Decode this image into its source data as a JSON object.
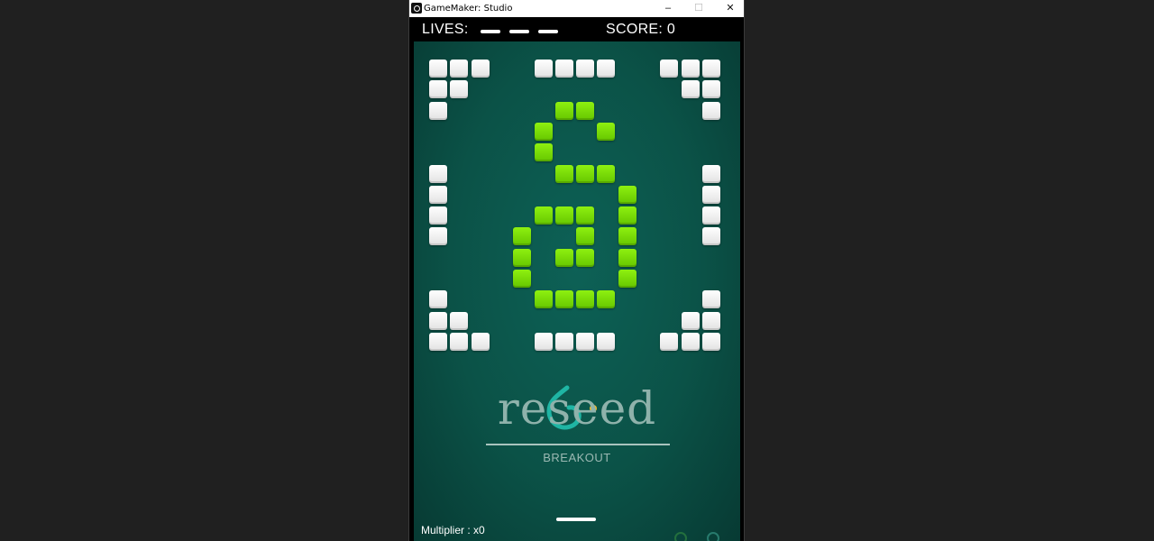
{
  "window": {
    "title": "GameMaker: Studio",
    "controls": {
      "minimize": "–",
      "maximize": "☐",
      "close": "✕"
    }
  },
  "hud": {
    "lives_label": "LIVES:",
    "lives_remaining": 3,
    "score_text": "SCORE: 0"
  },
  "colors": {
    "white_brick": "#ffffff",
    "green_brick": "#7ddc0a",
    "background": "#0b5247",
    "logo_accent": "#1fb5a4",
    "logo_dot": "#f2b92a"
  },
  "bricks": {
    "white": [
      [
        0,
        0
      ],
      [
        1,
        0
      ],
      [
        2,
        0
      ],
      [
        5,
        0
      ],
      [
        6,
        0
      ],
      [
        7,
        0
      ],
      [
        8,
        0
      ],
      [
        11,
        0
      ],
      [
        12,
        0
      ],
      [
        13,
        0
      ],
      [
        0,
        1
      ],
      [
        1,
        1
      ],
      [
        12,
        1
      ],
      [
        13,
        1
      ],
      [
        0,
        2
      ],
      [
        13,
        2
      ],
      [
        0,
        5
      ],
      [
        13,
        5
      ],
      [
        0,
        6
      ],
      [
        13,
        6
      ],
      [
        0,
        7
      ],
      [
        13,
        7
      ],
      [
        0,
        8
      ],
      [
        13,
        8
      ],
      [
        0,
        11
      ],
      [
        13,
        11
      ],
      [
        0,
        12
      ],
      [
        1,
        12
      ],
      [
        12,
        12
      ],
      [
        13,
        12
      ],
      [
        0,
        13
      ],
      [
        1,
        13
      ],
      [
        2,
        13
      ],
      [
        5,
        13
      ],
      [
        6,
        13
      ],
      [
        7,
        13
      ],
      [
        8,
        13
      ],
      [
        11,
        13
      ],
      [
        12,
        13
      ],
      [
        13,
        13
      ]
    ],
    "green": [
      [
        6,
        2
      ],
      [
        7,
        2
      ],
      [
        5,
        3
      ],
      [
        8,
        3
      ],
      [
        5,
        4
      ],
      [
        6,
        5
      ],
      [
        7,
        5
      ],
      [
        8,
        5
      ],
      [
        9,
        6
      ],
      [
        5,
        7
      ],
      [
        6,
        7
      ],
      [
        7,
        7
      ],
      [
        9,
        7
      ],
      [
        4,
        8
      ],
      [
        7,
        8
      ],
      [
        9,
        8
      ],
      [
        4,
        9
      ],
      [
        6,
        9
      ],
      [
        7,
        9
      ],
      [
        9,
        9
      ],
      [
        4,
        10
      ],
      [
        9,
        10
      ],
      [
        5,
        11
      ],
      [
        6,
        11
      ],
      [
        7,
        11
      ],
      [
        8,
        11
      ]
    ]
  },
  "logo": {
    "brand": "reseed",
    "subtitle": "BREAKOUT"
  },
  "footer": {
    "multiplier_text": "Multiplier : x0",
    "icons": [
      "leaf-badge-icon",
      "sprout-badge-icon"
    ]
  }
}
